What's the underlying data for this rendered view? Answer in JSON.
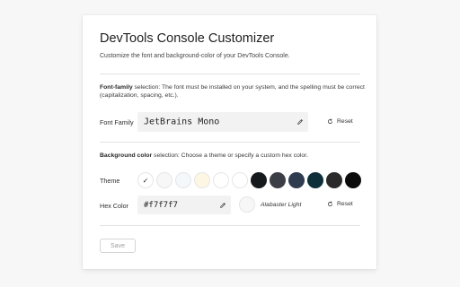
{
  "header": {
    "title": "DevTools Console Customizer",
    "subtitle": "Customize the font and background-color of your DevTools Console."
  },
  "font_section": {
    "description_bold": "Font-family",
    "description_rest": " selection: The font must be installed on your system, and the spelling must be correct (capitalization, spacing, etc.).",
    "label": "Font Family",
    "value": "JetBrains Mono",
    "reset_label": "Reset"
  },
  "background_section": {
    "description_bold": "Background color",
    "description_rest": " selection: Choose a theme or specify a custom hex color.",
    "theme_label": "Theme",
    "selected_mark": "✓",
    "themes": [
      {
        "color": "#ffffff",
        "selected": true
      },
      {
        "color": "#f7f7f7",
        "selected": false
      },
      {
        "color": "#f4f8fb",
        "selected": false
      },
      {
        "color": "#fdf6e3",
        "selected": false
      },
      {
        "color": "#ffffff",
        "selected": false
      },
      {
        "color": "#ffffff",
        "selected": false
      },
      {
        "color": "#161a1d",
        "selected": false
      },
      {
        "color": "#3b3f45",
        "selected": false
      },
      {
        "color": "#2f3b4e",
        "selected": false
      },
      {
        "color": "#0e2f3a",
        "selected": false
      },
      {
        "color": "#2a2a2a",
        "selected": false
      },
      {
        "color": "#0b0b0b",
        "selected": false
      }
    ],
    "hex_label": "Hex Color",
    "hex_value": "#f7f7f7",
    "preview_name": "Alabaster Light",
    "reset_label": "Reset"
  },
  "footer": {
    "save_label": "Save"
  }
}
